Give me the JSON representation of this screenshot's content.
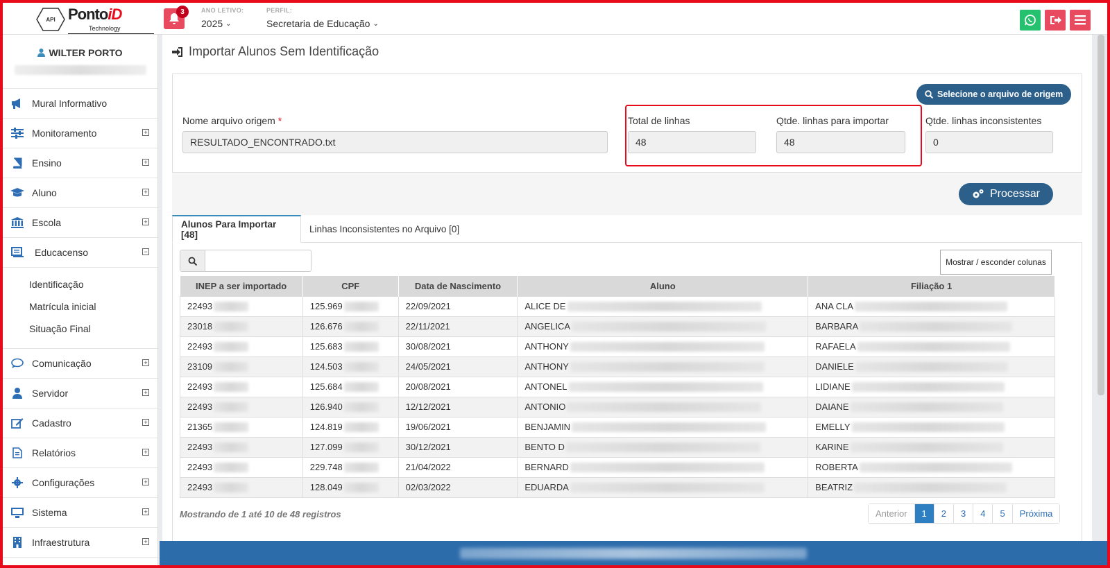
{
  "header": {
    "brand_main": "Ponto",
    "brand_accent": "iD",
    "brand_sub": "Technology",
    "logo_badge": "API",
    "notifications_count": "3",
    "ano_caption": "ANO LETIVO:",
    "ano_value": "2025",
    "perfil_caption": "PERFIL:",
    "perfil_value": "Secretaria de Educação"
  },
  "user": {
    "name": "WILTER PORTO"
  },
  "sidebar": {
    "items": [
      {
        "label": "Mural Informativo",
        "icon": "megaphone-icon"
      },
      {
        "label": "Monitoramento",
        "icon": "sliders-icon"
      },
      {
        "label": "Ensino",
        "icon": "book-icon"
      },
      {
        "label": "Aluno",
        "icon": "graduation-cap-icon"
      },
      {
        "label": "Escola",
        "icon": "bank-icon"
      },
      {
        "label": "Educacenso",
        "icon": "monitor-list-icon"
      },
      {
        "label": "Comunicação",
        "icon": "chat-bubble-icon"
      },
      {
        "label": "Servidor",
        "icon": "user-icon"
      },
      {
        "label": "Cadastro",
        "icon": "edit-icon"
      },
      {
        "label": "Relatórios",
        "icon": "file-text-icon"
      },
      {
        "label": "Configurações",
        "icon": "gear-icon"
      },
      {
        "label": "Sistema",
        "icon": "desktop-icon"
      },
      {
        "label": "Infraestrutura",
        "icon": "building-icon"
      }
    ],
    "educacenso_sub": [
      "Identificação",
      "Matrícula inicial",
      "Situação Final"
    ]
  },
  "page": {
    "title": "Importar Alunos Sem Identificação",
    "select_file_btn": "Selecione o arquivo de origem",
    "file_label": "Nome arquivo origem",
    "file_required": "*",
    "file_value": "RESULTADO_ENCONTRADO.txt",
    "total_label": "Total de linhas",
    "total_value": "48",
    "import_label": "Qtde. linhas para importar",
    "import_value": "48",
    "inconsistent_label": "Qtde. linhas inconsistentes",
    "inconsistent_value": "0",
    "process_btn": "Processar"
  },
  "tabs": [
    "Alunos Para Importar [48]",
    "Linhas Inconsistentes no Arquivo [0]"
  ],
  "table": {
    "toggle_cols": "Mostrar / esconder colunas",
    "headers": [
      "INEP a ser importado",
      "CPF",
      "Data de Nascimento",
      "Aluno",
      "Filiação 1"
    ],
    "rows": [
      [
        "22493",
        "125.969",
        "22/09/2021",
        "ALICE DE",
        "ANA CLA"
      ],
      [
        "23018",
        "126.676",
        "22/11/2021",
        "ANGELICA",
        "BARBARA"
      ],
      [
        "22493",
        "125.683",
        "30/08/2021",
        "ANTHONY",
        "RAFAELA"
      ],
      [
        "23109",
        "124.503",
        "24/05/2021",
        "ANTHONY",
        "DANIELE"
      ],
      [
        "22493",
        "125.684",
        "20/08/2021",
        "ANTONEL",
        "LIDIANE"
      ],
      [
        "22493",
        "126.940",
        "12/12/2021",
        "ANTONIO",
        "DAIANE"
      ],
      [
        "21365",
        "124.819",
        "19/06/2021",
        "BENJAMIN",
        "EMELLY"
      ],
      [
        "22493",
        "127.099",
        "30/12/2021",
        "BENTO D",
        "KARINE"
      ],
      [
        "22493",
        "229.748",
        "21/04/2022",
        "BERNARD",
        "ROBERTA"
      ],
      [
        "22493",
        "128.049",
        "02/03/2022",
        "EDUARDA",
        "BEATRIZ"
      ]
    ],
    "info": "Mostrando de 1 até 10 de 48 registros",
    "pager": [
      "Anterior",
      "1",
      "2",
      "3",
      "4",
      "5",
      "Próxima"
    ],
    "current_page": "1"
  },
  "colors": {
    "accent": "#2d5f8b",
    "alert": "#e84a5f",
    "whatsapp": "#25c16f",
    "highlight": "#e8091a"
  }
}
